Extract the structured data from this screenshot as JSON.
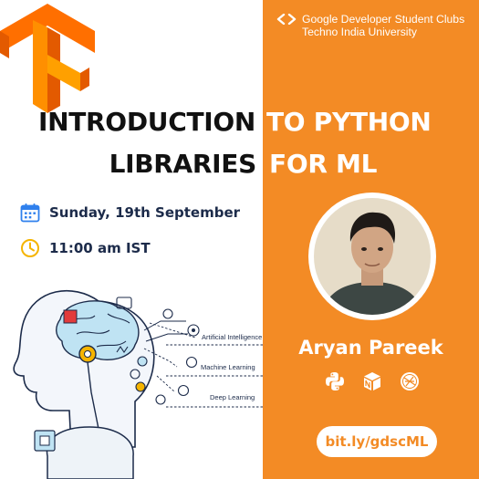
{
  "brand": {
    "org_name": "Google Developer Student Clubs",
    "org_sub": "Techno India University",
    "logo_icon": "gdsc-brackets-icon",
    "tf_logo_icon": "tensorflow-logo"
  },
  "title": {
    "line1_dark": "INTRODUCTION",
    "line1_light": "TO PYTHON",
    "line2_dark": "LIBRARIES",
    "line2_light": "FOR ML"
  },
  "event": {
    "date": "Sunday, 19th September",
    "time": "11:00 am IST",
    "date_icon": "calendar-icon",
    "time_icon": "clock-icon"
  },
  "illustration": {
    "labels": [
      "Artificial Intelligence",
      "Machine Learning",
      "Deep Learning"
    ]
  },
  "speaker": {
    "name": "Aryan Pareek",
    "tools": [
      "python-icon",
      "numpy-icon",
      "scikit-learn-icon"
    ]
  },
  "link": {
    "text": "bit.ly/gdscML"
  },
  "colors": {
    "accent": "#F38B25",
    "navy": "#1c2b4a",
    "text_dark": "#111111",
    "white": "#ffffff"
  }
}
